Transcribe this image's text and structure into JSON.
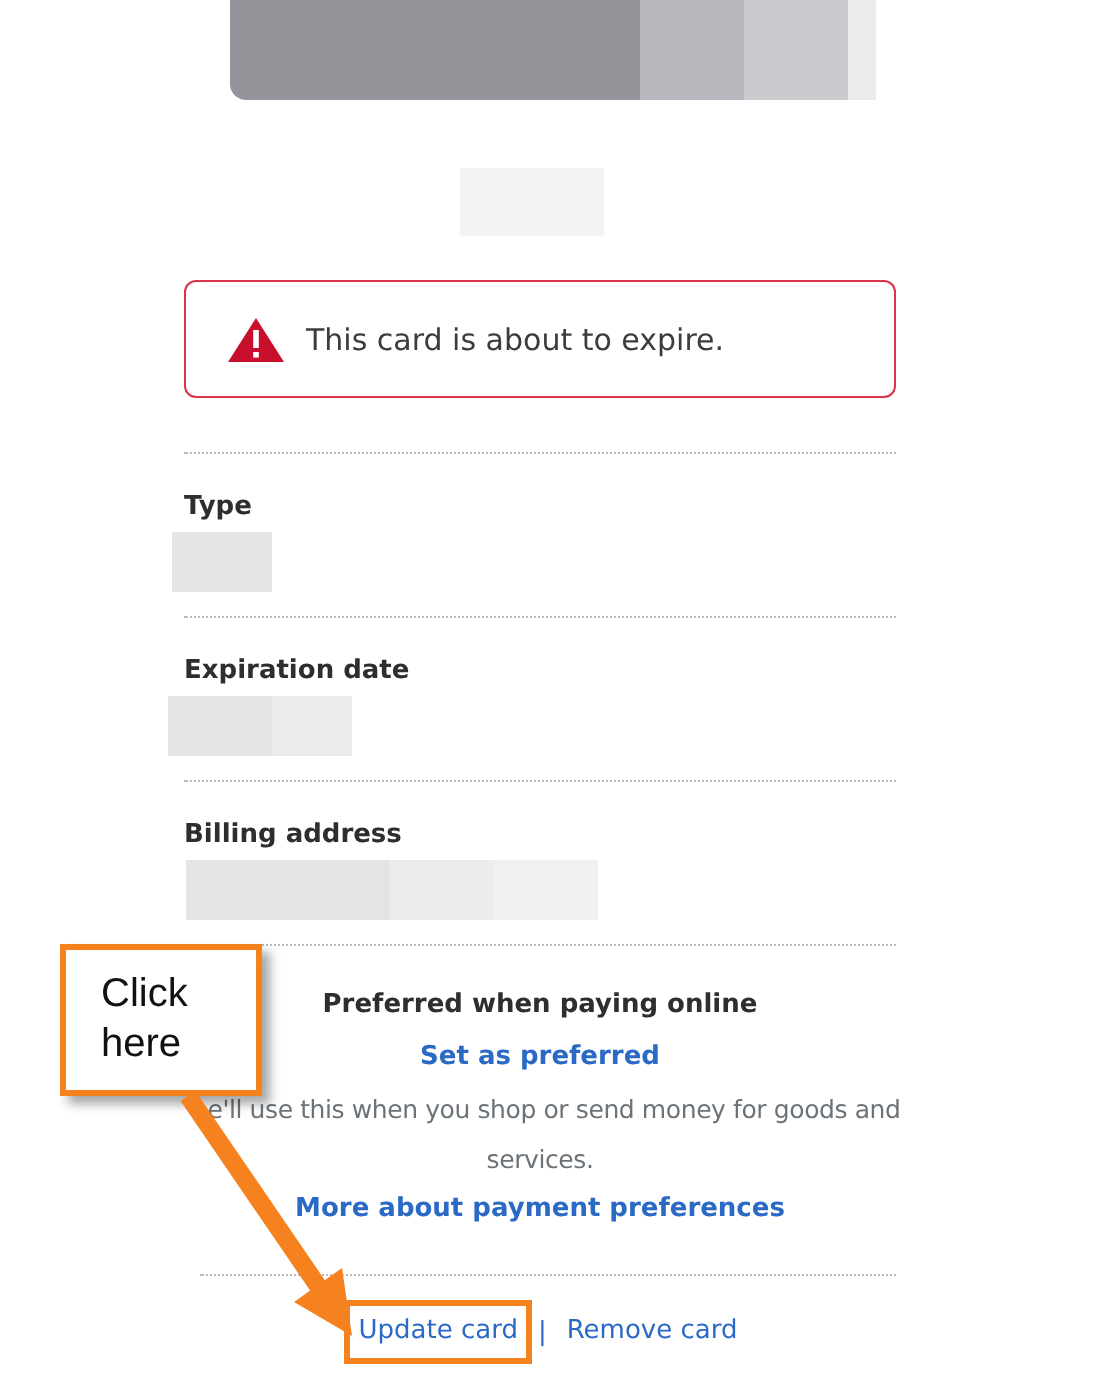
{
  "alert": {
    "message": "This card is about to expire."
  },
  "fields": [
    {
      "label": "Type"
    },
    {
      "label": "Expiration date"
    },
    {
      "label": "Billing address"
    }
  ],
  "preferred": {
    "heading": "Preferred when paying online",
    "action": "Set as preferred",
    "description": "e'll use this when you shop or send money for goods and services.",
    "link": "More about payment preferences"
  },
  "actions": [
    {
      "label": "Update card",
      "highlighted": true
    },
    {
      "label": "Remove card",
      "highlighted": false
    }
  ],
  "separator": "|",
  "annotation": {
    "text": "Click here"
  }
}
